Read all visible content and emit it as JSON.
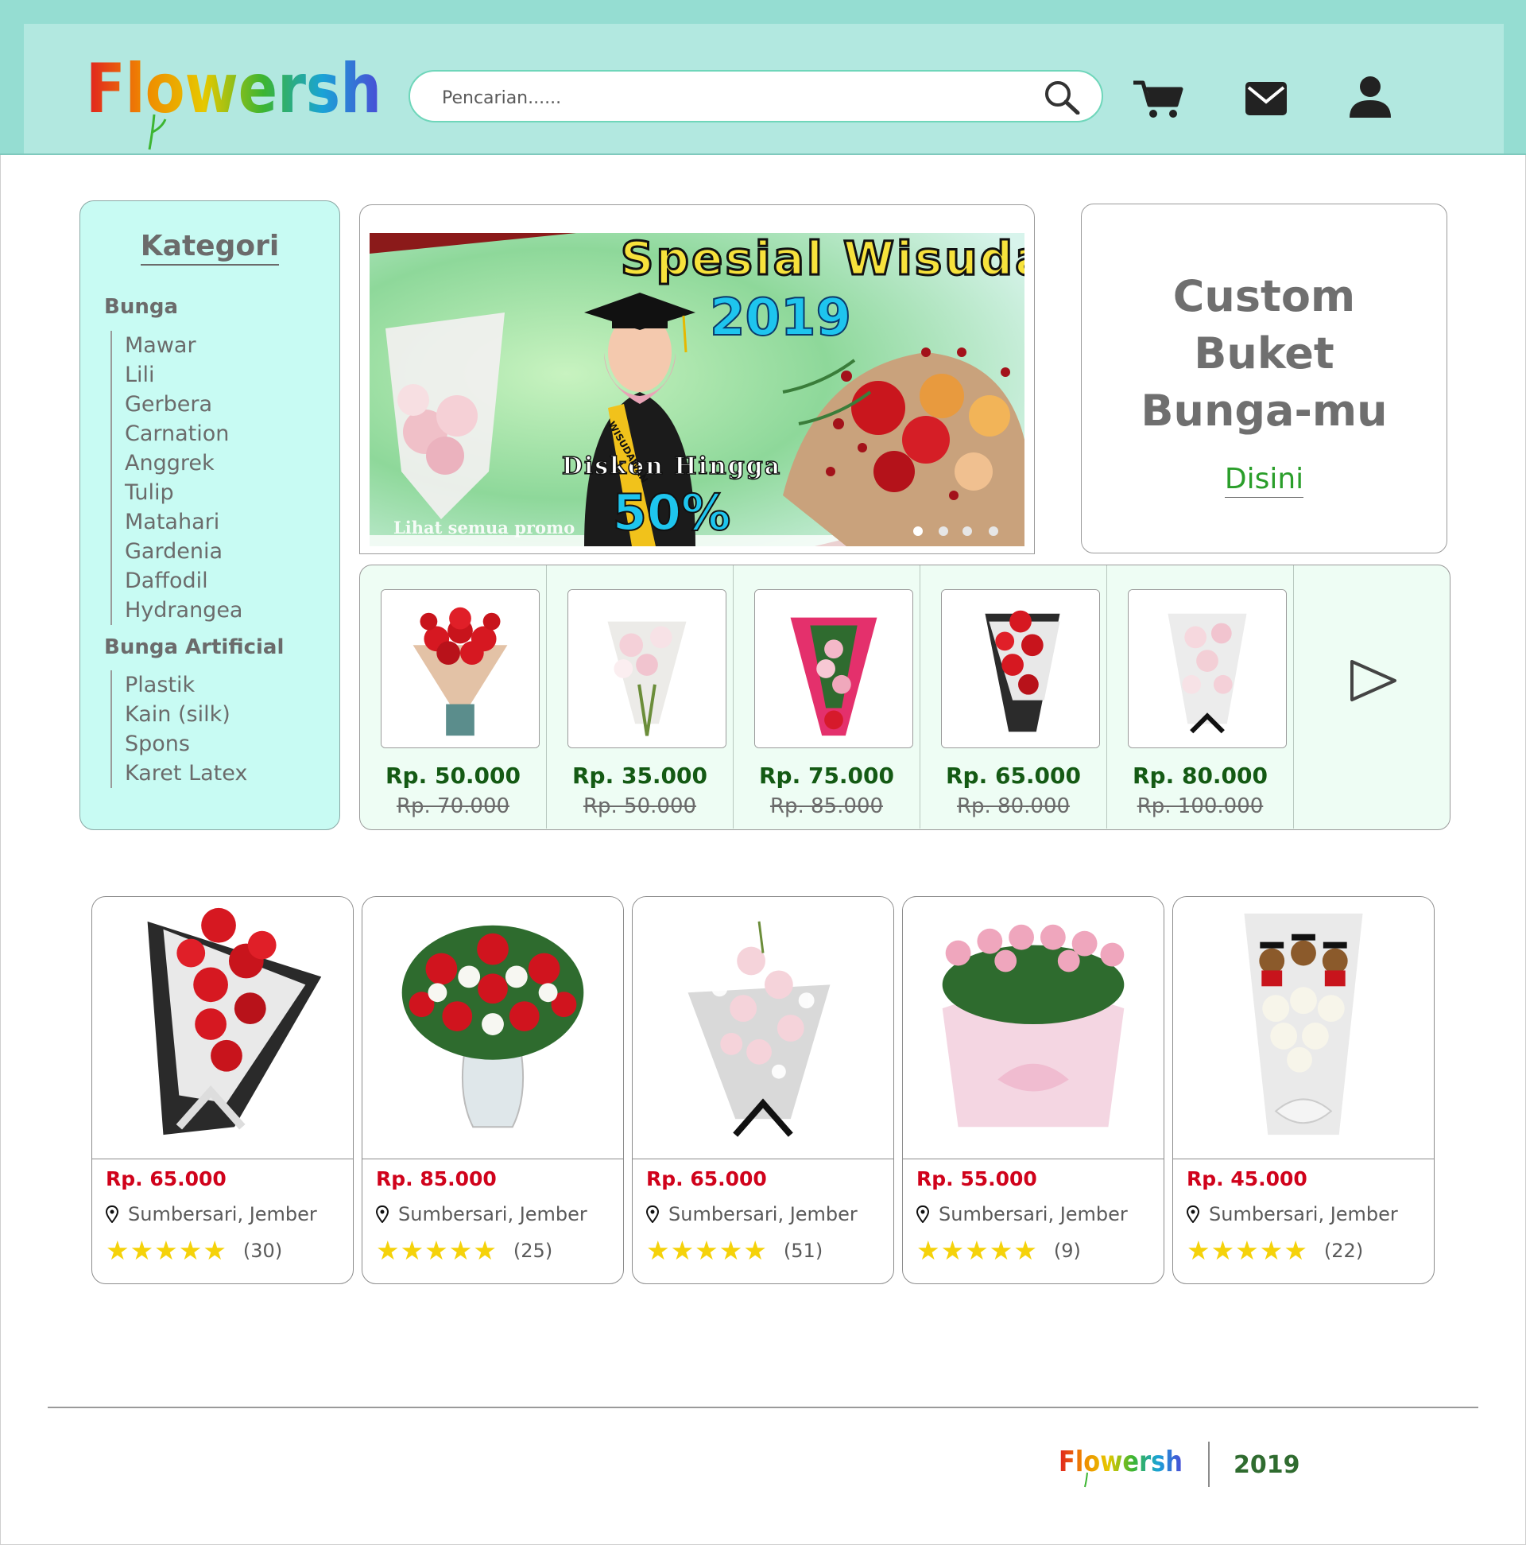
{
  "brand": {
    "name": "Flowersh"
  },
  "header": {
    "search_placeholder": "Pencarian......",
    "icons": [
      "search-icon",
      "cart-icon",
      "mail-icon",
      "user-icon"
    ]
  },
  "category": {
    "title": "Kategori",
    "groups": [
      {
        "label": "Bunga",
        "items": [
          "Mawar",
          "Lili",
          "Gerbera",
          "Carnation",
          "Anggrek",
          "Tulip",
          "Matahari",
          "Gardenia",
          "Daffodil",
          "Hydrangea"
        ]
      },
      {
        "label": "Bunga Artificial",
        "items": [
          "Plastik",
          "Kain (silk)",
          "Spons",
          "Karet Latex"
        ]
      }
    ]
  },
  "banner": {
    "title": "Spesial Wisuda",
    "year": "2019",
    "discount_label": "Diskon Hingga",
    "discount_value": "50%",
    "link": "Lihat semua promo",
    "sash_text": "WISUDAWAN",
    "slide_count": 4,
    "active_slide": 1
  },
  "custom": {
    "title_lines": [
      "Custom",
      "Buket",
      "Bunga-mu"
    ],
    "link": "Disini"
  },
  "promos": [
    {
      "price": "Rp. 50.000",
      "old_price": "Rp. 70.000"
    },
    {
      "price": "Rp. 35.000",
      "old_price": "Rp. 50.000"
    },
    {
      "price": "Rp. 75.000",
      "old_price": "Rp. 85.000"
    },
    {
      "price": "Rp. 65.000",
      "old_price": "Rp. 80.000"
    },
    {
      "price": "Rp. 80.000",
      "old_price": "Rp. 100.000"
    }
  ],
  "products": [
    {
      "price": "Rp. 65.000",
      "location": "Sumbersari, Jember",
      "stars": "★★★★★",
      "reviews": "(30)"
    },
    {
      "price": "Rp. 85.000",
      "location": "Sumbersari, Jember",
      "stars": "★★★★★",
      "reviews": "(25)"
    },
    {
      "price": "Rp. 65.000",
      "location": "Sumbersari, Jember",
      "stars": "★★★★★",
      "reviews": "(51)"
    },
    {
      "price": "Rp. 55.000",
      "location": "Sumbersari, Jember",
      "stars": "★★★★★",
      "reviews": "(9)"
    },
    {
      "price": "Rp. 45.000",
      "location": "Sumbersari, Jember",
      "stars": "★★★★★",
      "reviews": "(22)"
    }
  ],
  "footer": {
    "year": "2019"
  },
  "colors": {
    "header": "#95ddd2",
    "header_inner": "#b2e8e0",
    "category_bg": "#c8fbf3",
    "promo_bg": "#eefdf4",
    "price_red": "#d0021b",
    "price_green": "#145a14",
    "link_green": "#2a9e2a",
    "star": "#f5d20a"
  }
}
